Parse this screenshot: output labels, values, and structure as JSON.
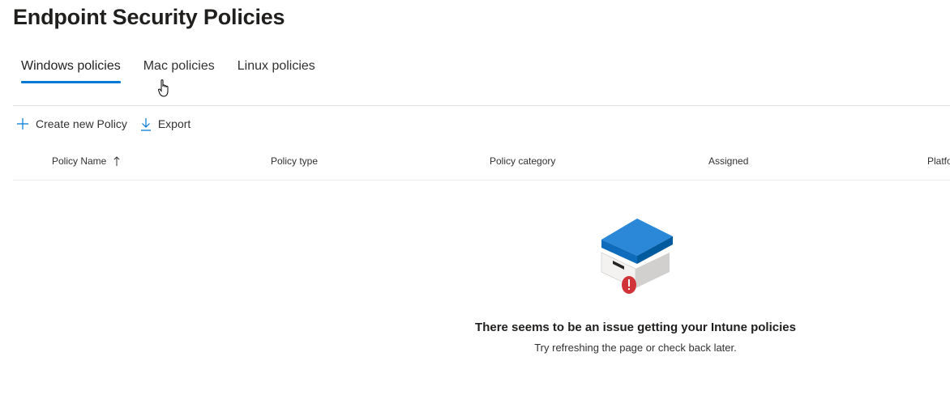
{
  "header": {
    "title": "Endpoint Security Policies"
  },
  "tabs": [
    {
      "label": "Windows policies",
      "active": true
    },
    {
      "label": "Mac policies",
      "active": false
    },
    {
      "label": "Linux policies",
      "active": false
    }
  ],
  "toolbar": {
    "create_label": "Create new Policy",
    "export_label": "Export"
  },
  "table": {
    "columns": [
      "Policy Name",
      "Policy type",
      "Policy category",
      "Assigned",
      "Platform"
    ],
    "sorted_column": "Policy Name",
    "sort_direction": "ascending"
  },
  "empty_state": {
    "title": "There seems to be an issue getting your Intune policies",
    "subtitle": "Try refreshing the page or check back later.",
    "icon": "box-error-icon"
  },
  "colors": {
    "accent": "#0078d4",
    "error": "#d13438"
  }
}
